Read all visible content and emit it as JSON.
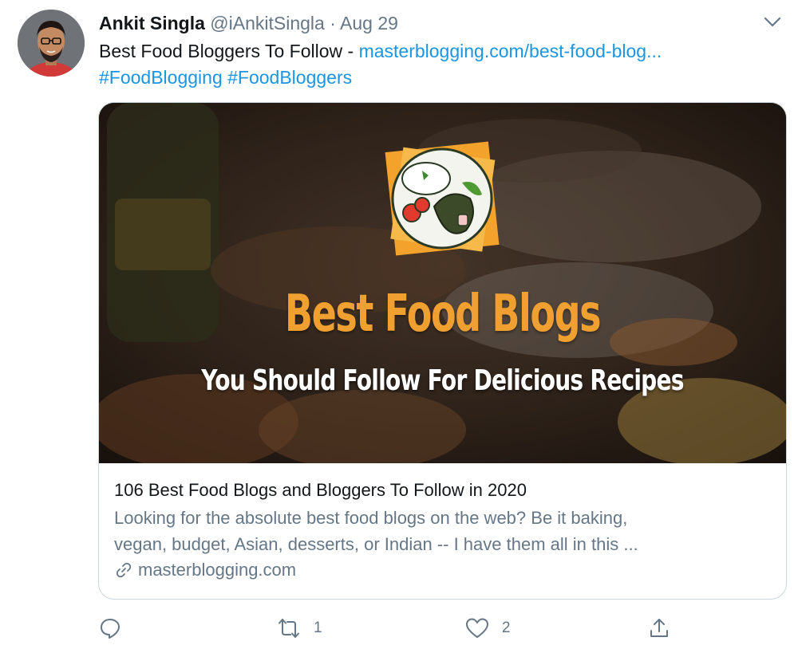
{
  "tweet": {
    "author_name": "Ankit Singla",
    "handle": "@iAnkitSingla",
    "separator": "·",
    "date": "Aug 29",
    "text_prefix": "Best Food Bloggers To Follow - ",
    "link_text": "masterblogging.com/best-food-blog...",
    "hashtags": [
      "#FoodBlogging",
      "#FoodBloggers"
    ]
  },
  "card": {
    "image_headline": "Best Food Blogs",
    "image_subheadline": "You Should Follow For Delicious Recipes",
    "title": "106 Best Food Blogs and Bloggers To Follow in 2020",
    "description_line1": "Looking for the absolute best food blogs on the web? Be it baking,",
    "description_line2": "vegan, budget, Asian, desserts, or Indian -- I have them all in this ...",
    "domain": "masterblogging.com"
  },
  "actions": {
    "reply_count": "",
    "retweet_count": "1",
    "like_count": "2"
  },
  "colors": {
    "link": "#1b95e0",
    "secondary_text": "#657786",
    "headline": "#f0a030"
  },
  "icons": [
    "chevron-down-icon",
    "link-icon",
    "reply-icon",
    "retweet-icon",
    "like-icon",
    "share-icon"
  ]
}
